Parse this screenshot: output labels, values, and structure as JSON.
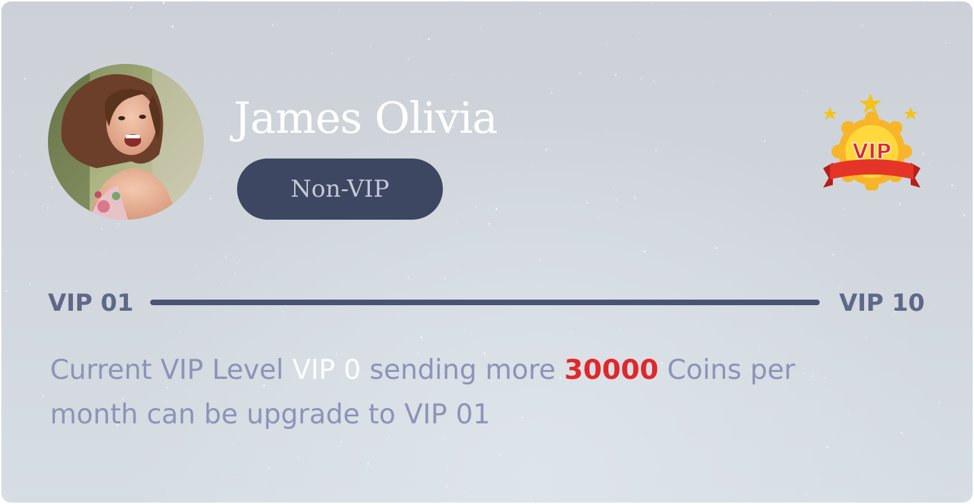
{
  "profile": {
    "name": "James Olivia",
    "status": "Non-VIP",
    "avatar": "profile-photo"
  },
  "badge": {
    "text": "VIP",
    "icon": "vip-medal-icon",
    "colors": {
      "gold": "#f5b41a",
      "ribbon": "#e53528",
      "text": "#e0282a"
    }
  },
  "progress": {
    "start_label": "VIP 01",
    "end_label": "VIP 10",
    "value": 0
  },
  "info": {
    "part1": "Current VIP Level ",
    "current_level": "VIP 0",
    "part2": " sending more ",
    "coins": "30000",
    "part3": " Coins per month can be upgrade to VIP 01"
  },
  "colors": {
    "pill_bg": "#3d4761",
    "track": "#4a5372",
    "muted_text": "#8d93b8",
    "highlight": "#e0282a"
  }
}
